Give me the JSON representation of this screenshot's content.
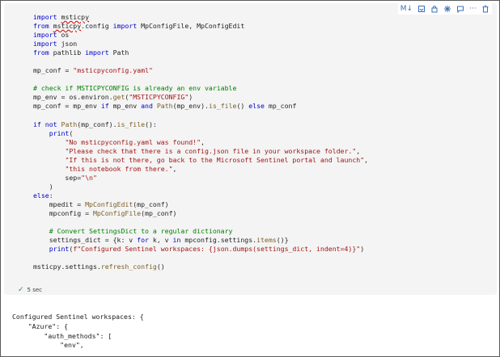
{
  "toolbar": {
    "markdown_label": "M↓",
    "items": [
      {
        "name": "markdown-icon",
        "glyph": "M↓"
      },
      {
        "name": "execute-above-icon",
        "glyph": ""
      },
      {
        "name": "split-cell-icon",
        "glyph": ""
      },
      {
        "name": "debug-icon",
        "glyph": ""
      },
      {
        "name": "comment-icon",
        "glyph": ""
      },
      {
        "name": "more-actions-icon",
        "glyph": "···"
      },
      {
        "name": "delete-icon",
        "glyph": ""
      }
    ]
  },
  "code": {
    "lines": [
      "import msticpy",
      "from msticpy.config import MpConfigFile, MpConfigEdit",
      "import os",
      "import json",
      "from pathlib import Path",
      "",
      "mp_conf = \"msticpyconfig.yaml\"",
      "",
      "# check if MSTICPYCONFIG is already an env variable",
      "mp_env = os.environ.get(\"MSTICPYCONFIG\")",
      "mp_conf = mp_env if mp_env and Path(mp_env).is_file() else mp_conf",
      "",
      "if not Path(mp_conf).is_file():",
      "    print(",
      "        \"No msticpyconfig.yaml was found!\",",
      "        \"Please check that there is a config.json file in your workspace folder.\",",
      "        \"If this is not there, go back to the Microsoft Sentinel portal and launch\",",
      "        \"this notebook from there.\",",
      "        sep=\"\\n\"",
      "    )",
      "else:",
      "    mpedit = MpConfigEdit(mp_conf)",
      "    mpconfig = MpConfigFile(mp_conf)",
      "",
      "    # Convert SettingsDict to a regular dictionary",
      "    settings_dict = {k: v for k, v in mpconfig.settings.items()}",
      "    print(f\"Configured Sentinel workspaces: {json.dumps(settings_dict, indent=4)}\")",
      "",
      "msticpy.settings.refresh_config()"
    ]
  },
  "status": {
    "check": "✓",
    "duration": "5 sec"
  },
  "output": {
    "lines": [
      "Configured Sentinel workspaces: {",
      "    \"Azure\": {",
      "        \"auth_methods\": [",
      "            \"env\","
    ]
  }
}
